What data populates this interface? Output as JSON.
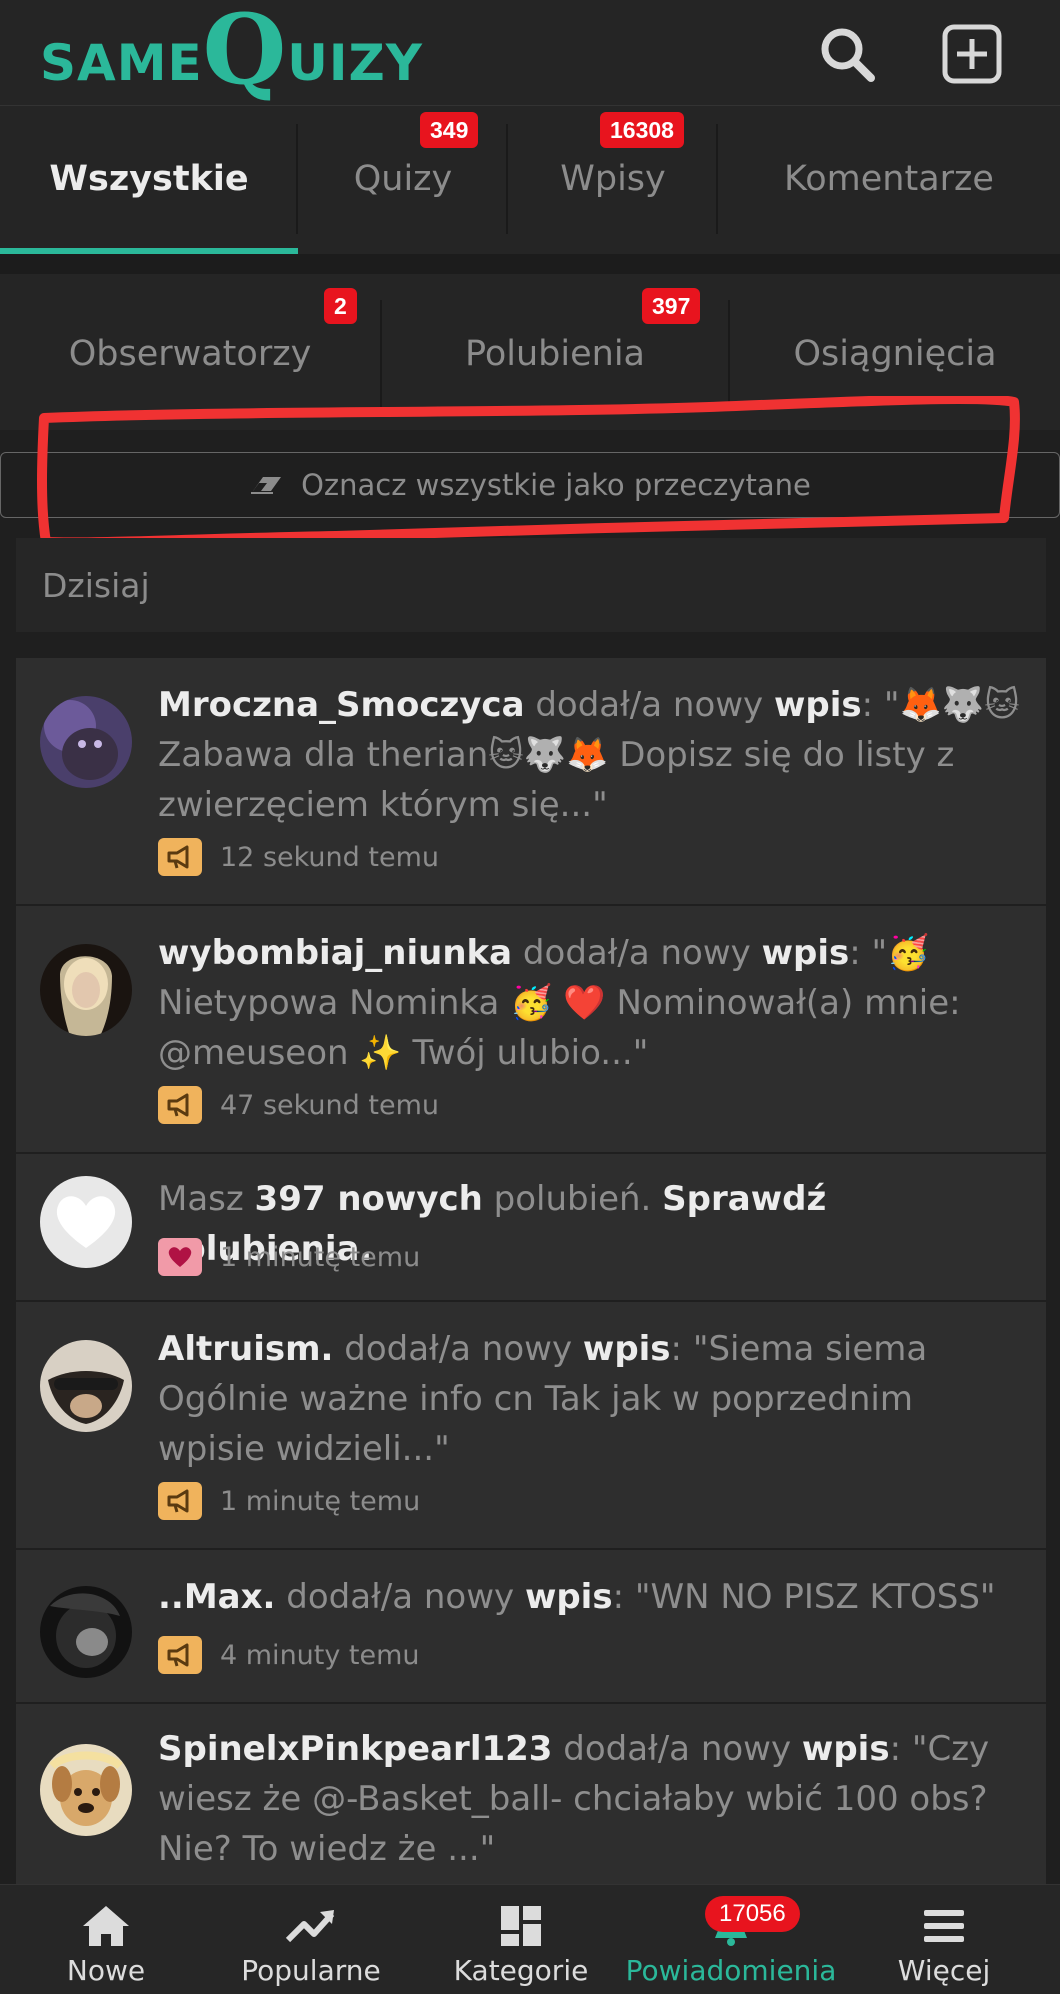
{
  "app": {
    "logo_same": "SAME",
    "logo_q": "Q",
    "logo_uizy": "UIZY",
    "brand_color": "#2bb89a"
  },
  "tabs1": [
    {
      "label": "Wszystkie",
      "badge": ""
    },
    {
      "label": "Quizy",
      "badge": "349"
    },
    {
      "label": "Wpisy",
      "badge": "16308"
    },
    {
      "label": "Komentarze",
      "badge": ""
    }
  ],
  "tabs2": [
    {
      "label": "Obserwatorzy",
      "badge": "2"
    },
    {
      "label": "Polubienia",
      "badge": "397"
    },
    {
      "label": "Osiągnięcia",
      "badge": ""
    }
  ],
  "mark_all_label": "Oznacz wszystkie jako przeczytane",
  "section_title": "Dzisiaj",
  "notifications": [
    {
      "user": "Mroczna_Smoczyca",
      "action": " dodał/a nowy ",
      "kind": "wpis",
      "sep": ": ",
      "text": "\"🦊🐺🐱 Zabawa dla therian🐱🐺🦊 Dopisz się do listy z zwierzęciem którym się...\"",
      "time": "12 sekund temu",
      "icon": "megaphone-icon"
    },
    {
      "user": "wybombiaj_niunka",
      "action": " dodał/a nowy ",
      "kind": "wpis",
      "sep": ": ",
      "text": "\"🥳 Nietypowa Nominka 🥳 ❤️ Nominował(a) mnie: @meuseon ✨ Twój ulubio...\"",
      "time": "47 sekund temu",
      "icon": "megaphone-icon"
    },
    {
      "prefix": "Masz ",
      "count": "397 nowych",
      "middle": " polubień. ",
      "link": "Sprawdź polubienia.",
      "time": "1 minutę temu",
      "icon": "heart-icon"
    },
    {
      "user": "Altruism.",
      "action": " dodał/a nowy ",
      "kind": "wpis",
      "sep": ": ",
      "text": "\"Siema siema Ogólnie ważne info cn Tak jak w poprzednim wpisie widzieli...\"",
      "time": "1 minutę temu",
      "icon": "megaphone-icon"
    },
    {
      "user": "..Max.",
      "action": " dodał/a nowy ",
      "kind": "wpis",
      "sep": ": ",
      "text": "\"WN NO PISZ KTOSS\"",
      "time": "4 minuty temu",
      "icon": "megaphone-icon"
    },
    {
      "user": "SpinelxPinkpearl123",
      "action": " dodał/a nowy ",
      "kind": "wpis",
      "sep": ": ",
      "text": "\"Czy wiesz że @-Basket_ball- chciałaby wbić 100 obs? Nie? To wiedz że ...\"",
      "time": "",
      "icon": "megaphone-icon"
    }
  ],
  "bottom_nav": [
    {
      "label": "Nowe",
      "icon": "home-icon"
    },
    {
      "label": "Popularne",
      "icon": "trending-icon"
    },
    {
      "label": "Kategorie",
      "icon": "grid-icon"
    },
    {
      "label": "Powiadomienia",
      "icon": "bell-icon",
      "badge": "17056"
    },
    {
      "label": "Więcej",
      "icon": "menu-icon"
    }
  ]
}
